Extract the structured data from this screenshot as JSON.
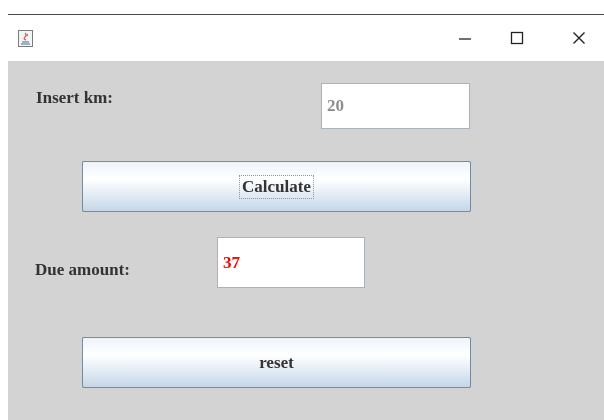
{
  "window": {
    "title": "",
    "controls": {
      "minimize": "minimize-icon",
      "maximize": "maximize-icon",
      "close": "close-icon"
    }
  },
  "form": {
    "km_label": "Insert km:",
    "km_value": "20",
    "calculate_label": "Calculate",
    "due_label": "Due amount:",
    "due_value": "37",
    "reset_label": "reset"
  },
  "colors": {
    "background": "#d3d3d3",
    "km_value_text": "#8c8c8c",
    "due_value_text": "#ff0000",
    "label_text": "#333333"
  }
}
